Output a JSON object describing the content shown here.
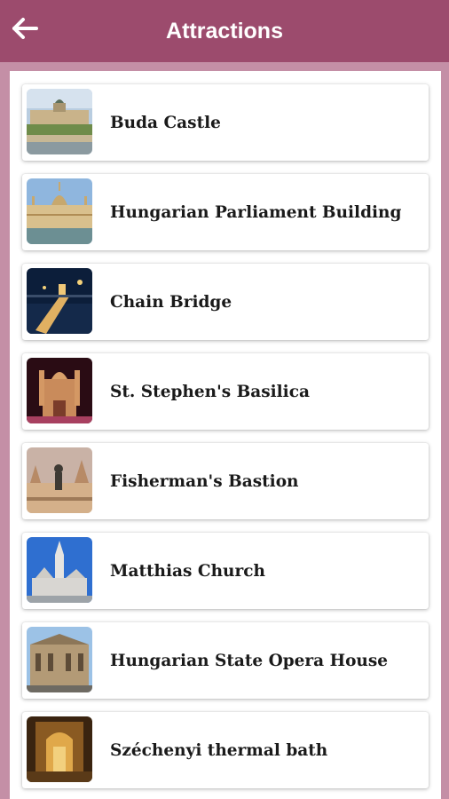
{
  "appbar": {
    "title": "Attractions",
    "back_icon": "arrow-left-icon",
    "background_color": "#9c4b6d",
    "title_color": "#ffffff"
  },
  "page_background_color": "#c48fa6",
  "attractions": [
    {
      "name": "Buda Castle",
      "thumbnail": "buda-castle-photo"
    },
    {
      "name": "Hungarian Parliament Building",
      "thumbnail": "parliament-photo"
    },
    {
      "name": "Chain Bridge",
      "thumbnail": "chain-bridge-photo"
    },
    {
      "name": "St. Stephen's Basilica",
      "thumbnail": "basilica-photo"
    },
    {
      "name": "Fisherman's Bastion",
      "thumbnail": "bastion-photo"
    },
    {
      "name": "Matthias Church",
      "thumbnail": "matthias-church-photo"
    },
    {
      "name": "Hungarian State Opera House",
      "thumbnail": "opera-house-photo"
    },
    {
      "name": "Széchenyi thermal bath",
      "thumbnail": "thermal-bath-photo"
    }
  ]
}
